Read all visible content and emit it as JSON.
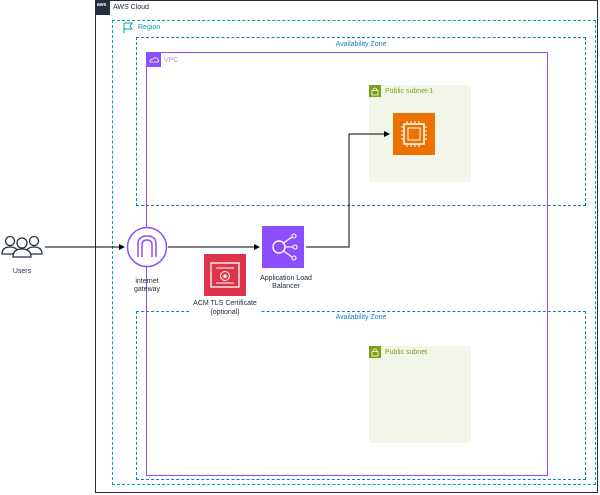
{
  "groups": {
    "aws_cloud": "AWS Cloud",
    "region": "Region",
    "az_top": "Availability Zone",
    "az_bottom": "Availability Zone",
    "vpc": "VPC",
    "subnet_top": "Public subnet-1",
    "subnet_bottom": "Public subnet"
  },
  "nodes": {
    "users": "Users",
    "igw_line1": "internet",
    "igw_line2": "gateway",
    "alb_line1": "Application Load",
    "alb_line2": "Balancer",
    "acm_line1": "ACM TLS Certificate",
    "acm_line2": "(optional)",
    "aws_logo": "aws"
  },
  "colors": {
    "aws_cloud": "#232f3e",
    "region": "#00a4a6",
    "availability_zone": "#147eba",
    "vpc": "#8c4fff",
    "public_subnet": "#7aa116",
    "subnet_fill": "#f2f6e8",
    "ec2": "#ed7100",
    "networking": "#8c4fff",
    "security": "#dd344c"
  },
  "icons": [
    "aws-logo-icon",
    "region-flag-icon",
    "vpc-cloud-icon",
    "lock-icon",
    "ec2-instance-icon",
    "users-icon",
    "internet-gateway-icon",
    "load-balancer-icon",
    "certificate-icon"
  ]
}
